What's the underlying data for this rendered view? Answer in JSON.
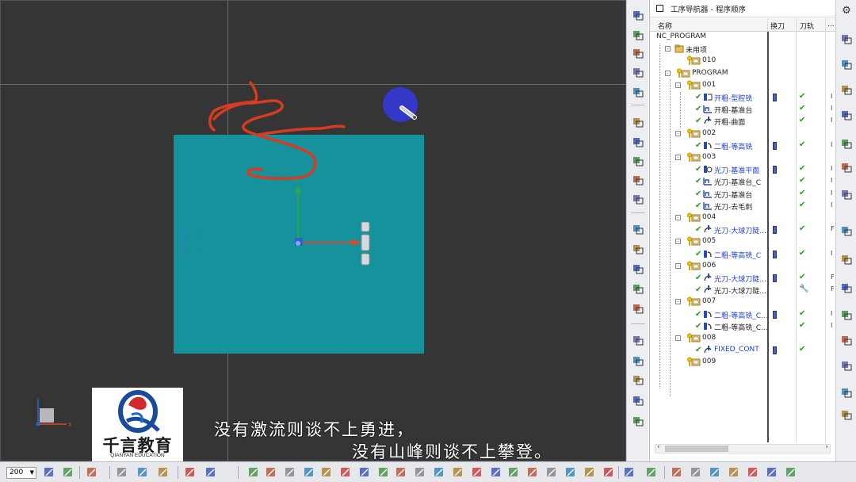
{
  "navigator": {
    "title": "工序导航器 - 程序顺序",
    "columns": {
      "name": "名称",
      "tool_change": "换刀",
      "toolpath": "刀轨",
      "extra": "..."
    },
    "rows": [
      {
        "level": 0,
        "name": "NC_PROGRAM",
        "kind": "root",
        "toggle": "",
        "tool": false,
        "path": "",
        "x": ""
      },
      {
        "level": 1,
        "name": "未用项",
        "kind": "folder",
        "toggle": "-",
        "tool": false,
        "path": "",
        "x": ""
      },
      {
        "level": 2,
        "name": "010",
        "kind": "program",
        "toggle": "",
        "tool": false,
        "path": "",
        "x": ""
      },
      {
        "level": 1,
        "name": "PROGRAM",
        "kind": "program",
        "toggle": "-",
        "tool": false,
        "path": "",
        "x": ""
      },
      {
        "level": 2,
        "name": "001",
        "kind": "program",
        "toggle": "-",
        "tool": false,
        "path": "",
        "x": ""
      },
      {
        "level": 3,
        "name": "开粗-型腔铣",
        "kind": "op-cavity",
        "blue": true,
        "toggle": "",
        "tool": true,
        "path": "check",
        "x": "I"
      },
      {
        "level": 3,
        "name": "开粗-基准台",
        "kind": "op-face",
        "toggle": "",
        "tool": false,
        "path": "check",
        "x": "I"
      },
      {
        "level": 3,
        "name": "开粗-曲面",
        "kind": "op-contour",
        "toggle": "",
        "tool": false,
        "path": "check",
        "x": "I"
      },
      {
        "level": 2,
        "name": "002",
        "kind": "program",
        "toggle": "-",
        "tool": false,
        "path": "",
        "x": ""
      },
      {
        "level": 3,
        "name": "二粗-等高铣",
        "kind": "op-zlevel",
        "blue": true,
        "toggle": "",
        "tool": true,
        "path": "check",
        "x": "I"
      },
      {
        "level": 2,
        "name": "003",
        "kind": "program",
        "toggle": "-",
        "tool": false,
        "path": "",
        "x": ""
      },
      {
        "level": 3,
        "name": "光刀-基准平面",
        "kind": "op-planar",
        "blue": true,
        "toggle": "",
        "tool": true,
        "path": "check",
        "x": "I"
      },
      {
        "level": 3,
        "name": "光刀-基准台_C",
        "kind": "op-face",
        "toggle": "",
        "tool": false,
        "path": "check",
        "x": "I"
      },
      {
        "level": 3,
        "name": "光刀-基准台",
        "kind": "op-face",
        "toggle": "",
        "tool": false,
        "path": "check",
        "x": "I"
      },
      {
        "level": 3,
        "name": "光刀-去毛刺",
        "kind": "op-face",
        "toggle": "",
        "tool": false,
        "path": "check",
        "x": "I"
      },
      {
        "level": 2,
        "name": "004",
        "kind": "program",
        "toggle": "-",
        "tool": false,
        "path": "",
        "x": ""
      },
      {
        "level": 3,
        "name": "光刀-大球刀陡...",
        "kind": "op-contour",
        "blue": true,
        "toggle": "",
        "tool": true,
        "path": "check",
        "x": "F"
      },
      {
        "level": 2,
        "name": "005",
        "kind": "program",
        "toggle": "-",
        "tool": false,
        "path": "",
        "x": ""
      },
      {
        "level": 3,
        "name": "二粗-等高铣_C",
        "kind": "op-zlevel",
        "blue": true,
        "toggle": "",
        "tool": true,
        "path": "check",
        "x": "I"
      },
      {
        "level": 2,
        "name": "006",
        "kind": "program",
        "toggle": "-",
        "tool": false,
        "path": "",
        "x": ""
      },
      {
        "level": 3,
        "name": "光刀-大球刀陡...",
        "kind": "op-contour",
        "blue": true,
        "toggle": "",
        "tool": true,
        "path": "check",
        "x": "F"
      },
      {
        "level": 3,
        "name": "光刀-大球刀陡...",
        "kind": "op-contour",
        "toggle": "",
        "tool": false,
        "path": "wrench",
        "x": "F"
      },
      {
        "level": 2,
        "name": "007",
        "kind": "program",
        "toggle": "-",
        "tool": false,
        "path": "",
        "x": ""
      },
      {
        "level": 3,
        "name": "二粗-等高铣_C...",
        "kind": "op-zlevel",
        "blue": true,
        "toggle": "",
        "tool": true,
        "path": "check",
        "x": "I"
      },
      {
        "level": 3,
        "name": "二粗-等高铣_C...",
        "kind": "op-zlevel",
        "toggle": "",
        "tool": false,
        "path": "check",
        "x": "I"
      },
      {
        "level": 2,
        "name": "008",
        "kind": "program",
        "toggle": "-",
        "tool": false,
        "path": "",
        "x": ""
      },
      {
        "level": 3,
        "name": "FIXED_CONT",
        "kind": "op-contour",
        "blue": true,
        "toggle": "",
        "tool": true,
        "path": "check",
        "x": ""
      },
      {
        "level": 2,
        "name": "009",
        "kind": "program",
        "toggle": "",
        "tool": false,
        "path": "",
        "x": ""
      }
    ]
  },
  "viewport": {
    "background": "#353535",
    "part_color": "#15929c",
    "annotation_color": "#d83a22",
    "cursor_color": "#3338c8"
  },
  "logo": {
    "name_cn": "千言教育",
    "name_en": "QIANYAN EDUCATION"
  },
  "subtitles": {
    "line1": "没有激流则谈不上勇进，",
    "line2": "没有山峰则谈不上攀登。"
  },
  "toolbar": {
    "zoom_value": "200"
  },
  "icons": {
    "left_toolbar": [
      "orient-icon",
      "wcs-icon",
      "geometry-icon",
      "mill-icon",
      "tool-icon",
      "program-icon",
      "operation-icon",
      "machine-icon",
      "copy-icon",
      "cut-icon",
      "paste-icon",
      "delete-icon",
      "generate-icon",
      "replay-icon",
      "verify-icon",
      "simulate-icon",
      "postprocess-icon",
      "shopdoc-icon"
    ],
    "right_toolbar": [
      "settings-gear-icon",
      "assembly-nav-icon",
      "constraint-nav-icon",
      "part-nav-icon",
      "operation-nav-icon",
      "reuse-library-icon",
      "hd3d-icon",
      "web-browser-icon",
      "history-icon",
      "palette-icon",
      "system-material-icon",
      "roles-icon",
      "process-studio-icon"
    ]
  }
}
